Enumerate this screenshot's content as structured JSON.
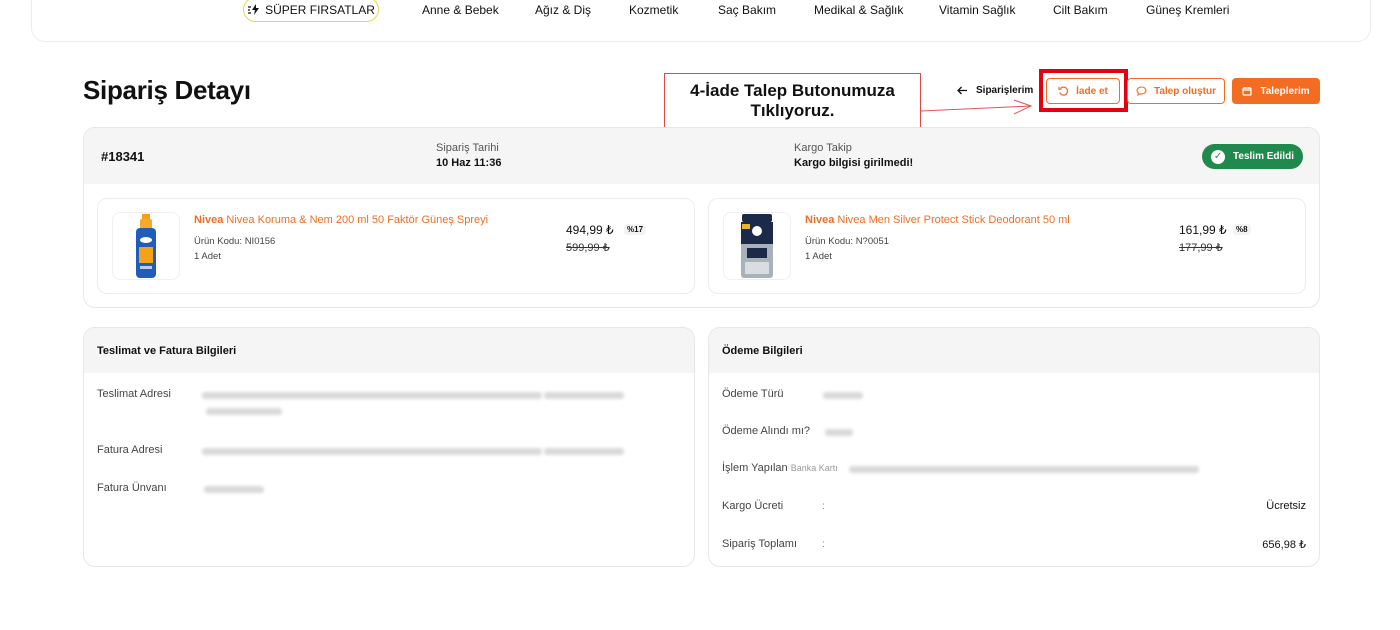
{
  "nav": {
    "super_label": "SÜPER FIRSATLAR",
    "links": [
      "Anne & Bebek",
      "Ağız & Diş",
      "Kozmetik",
      "Saç Bakım",
      "Medikal & Sağlık",
      "Vitamin Sağlık",
      "Cilt Bakım",
      "Güneş Kremleri"
    ]
  },
  "page": {
    "title": "Sipariş Detayı",
    "back_label": "Siparişlerim",
    "iade_label": "İade et",
    "talep_olustur_label": "Talep oluştur",
    "taleplerim_label": "Taleplerim"
  },
  "annotation": {
    "text": "4-İade Talep Butonumuza Tıklıyoruz."
  },
  "order": {
    "number": "#18341",
    "date_label": "Sipariş Tarihi",
    "date_value": "10 Haz 11:36",
    "cargo_label": "Kargo Takip",
    "cargo_value": "Kargo bilgisi girilmedi!",
    "status": "Teslim Edildi"
  },
  "products": [
    {
      "brand": "Nivea",
      "name": "Nivea Koruma & Nem 200 ml 50 Faktör Güneş Spreyi",
      "code": "Ürün Kodu: NI0156",
      "qty": "1 Adet",
      "price": "494,99 ₺",
      "old_price": "599,99 ₺",
      "discount": "%17"
    },
    {
      "brand": "Nivea",
      "name": "Nivea Men Silver Protect Stick Deodorant 50 ml",
      "code": "Ürün Kodu: N?0051",
      "qty": "1 Adet",
      "price": "161,99 ₺",
      "old_price": "177,99 ₺",
      "discount": "%8"
    }
  ],
  "delivery": {
    "title": "Teslimat ve Fatura Bilgileri",
    "address_label": "Teslimat Adresi",
    "invoice_label": "Fatura Adresi",
    "invoice_title_label": "Fatura Ünvanı"
  },
  "payment": {
    "title": "Ödeme Bilgileri",
    "type_label": "Ödeme Türü",
    "received_label": "Ödeme Alındı mı?",
    "bank_label": "İşlem Yapılan",
    "bank_sublabel": "Banka Kartı",
    "cargo_fee_label": "Kargo Ücreti",
    "cargo_fee_value": "Ücretsiz",
    "total_label": "Sipariş Toplamı",
    "total_value": "656,98 ₺",
    "colon": ":"
  },
  "colors": {
    "accent": "#f26d21",
    "success": "#1f8a4c",
    "highlight": "#e3000f"
  }
}
